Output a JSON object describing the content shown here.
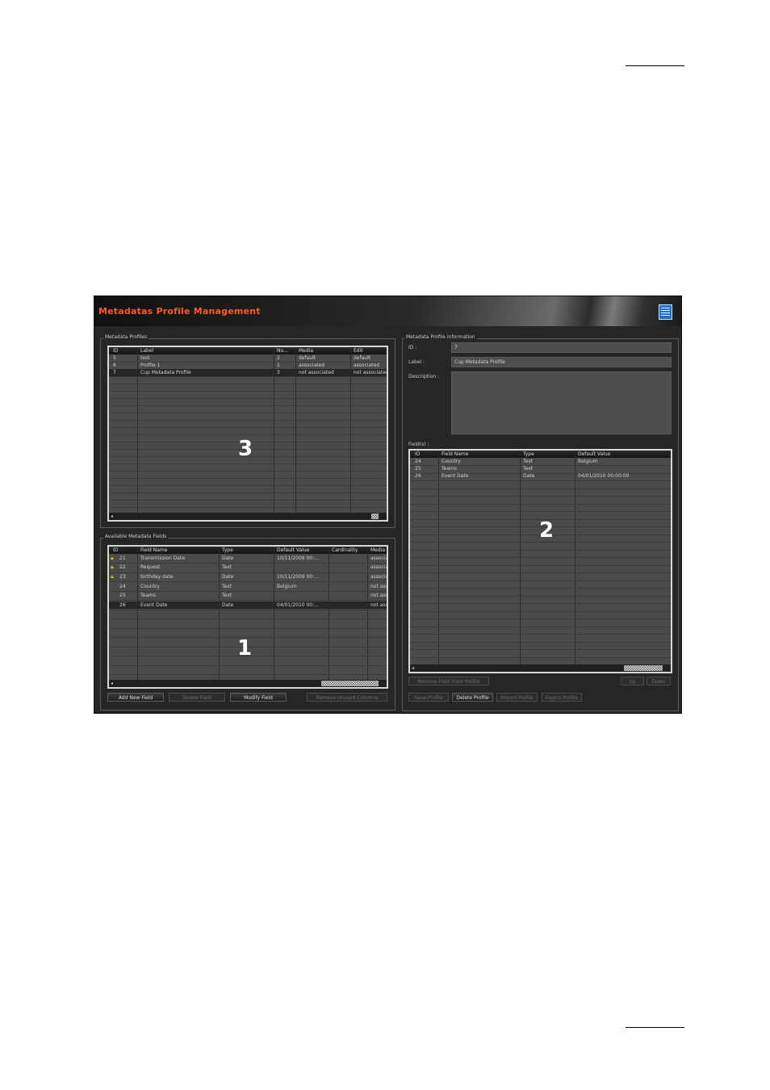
{
  "window": {
    "title": "Metadatas Profile Management",
    "icon": "notepad-icon"
  },
  "profiles": {
    "group_label": "Metadata Profiles",
    "columns": [
      "ID",
      "Label",
      "Nu...",
      "Media",
      "Edit"
    ],
    "rows": [
      [
        "5",
        "test",
        "2",
        "default",
        "default"
      ],
      [
        "6",
        "Profile 1",
        "1",
        "associated",
        "associated"
      ],
      [
        "7",
        "Cup Metadata Profile",
        "3",
        "not associated",
        "not associated"
      ]
    ],
    "callout": "3"
  },
  "fields": {
    "group_label": "Available Metadata Fields",
    "columns": [
      "ID",
      "Field Name",
      "Type",
      "Default Value",
      "Cardinality",
      "Media"
    ],
    "rows": [
      [
        "21",
        "Transmission Date",
        "Date",
        "10/11/2009 00:...",
        "",
        "associated"
      ],
      [
        "22",
        "Request",
        "Text",
        "",
        "",
        "associated"
      ],
      [
        "23",
        "birthday date",
        "Date",
        "10/11/2009 00:...",
        "",
        "associated"
      ],
      [
        "24",
        "Country",
        "Text",
        "Belgium",
        "",
        "not associated"
      ],
      [
        "25",
        "Teams",
        "Text",
        "",
        "",
        "not associated"
      ],
      [
        "26",
        "Event Date",
        "Date",
        "04/01/2010 00:...",
        "",
        "not associated"
      ]
    ],
    "locked_ids": [
      "21",
      "22",
      "23"
    ],
    "callout": "1",
    "buttons": {
      "add": "Add New Field",
      "delete": "Delete Field",
      "modify": "Modify Field",
      "remove_unused": "Remove Unused Columns"
    }
  },
  "info": {
    "group_label": "Metadata Profile Information",
    "id_label": "ID :",
    "id_value": "7",
    "label_label": "Label :",
    "label_value": "Cup Metadata Profile",
    "description_label": "Description :",
    "description_value": "",
    "fields_label": "Field(s) :",
    "columns": [
      "ID",
      "Field Name",
      "Type",
      "Default Value"
    ],
    "rows": [
      [
        "24",
        "Country",
        "Text",
        "Belgium"
      ],
      [
        "25",
        "Teams",
        "Text",
        ""
      ],
      [
        "26",
        "Event Date",
        "Date",
        "04/01/2010 00:00:00"
      ]
    ],
    "callout": "2",
    "buttons": {
      "remove_field": "Remove Field From Profile",
      "up": "Up",
      "down": "Down",
      "save": "Save Profile",
      "delete": "Delete Profile",
      "import": "Import Profile",
      "export": "Export Profile"
    }
  }
}
